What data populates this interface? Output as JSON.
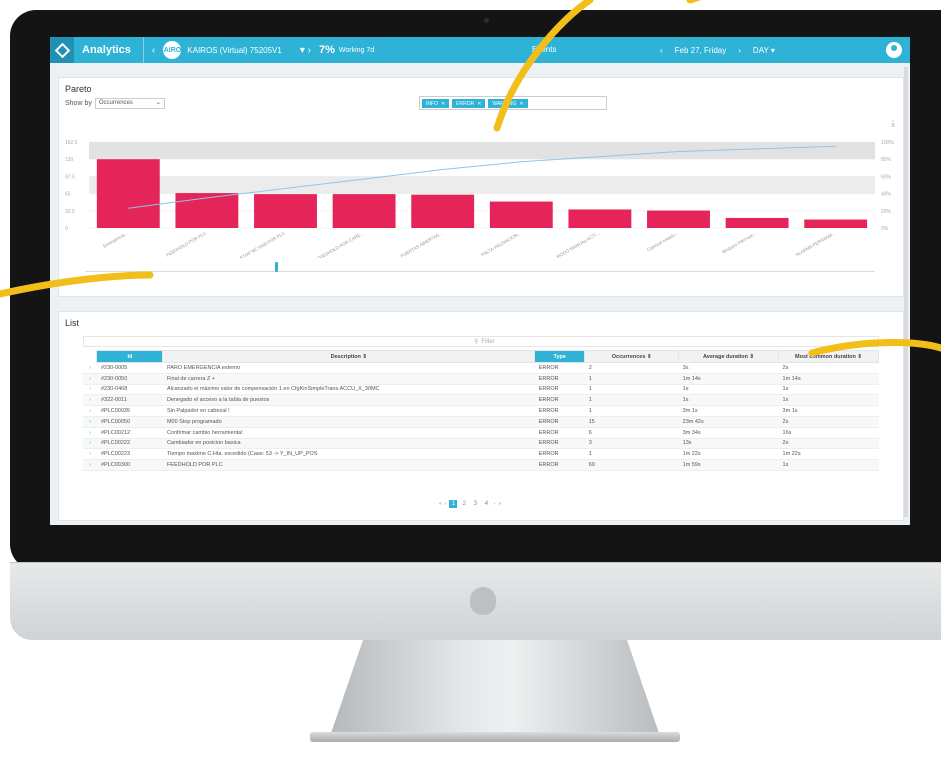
{
  "topbar": {
    "app_title": "Analytics",
    "machine_avatar": "KAIROS",
    "machine_name": "KAIROS (Virtual) 75205V1",
    "machine_pct": "7%",
    "machine_state": "Working 7d",
    "section": "Events",
    "date": "Feb 27, Friday",
    "period": "DAY"
  },
  "pareto": {
    "title": "Pareto",
    "show_by_label": "Show by",
    "show_by_value": "Occurrences",
    "filter_chips": [
      "INFO",
      "ERROR",
      "WARNING"
    ],
    "y_left_ticks": [
      "0",
      "32.5",
      "65",
      "97.5",
      "130",
      "162.5"
    ],
    "y_right_ticks": [
      "0%",
      "20%",
      "40%",
      "60%",
      "80%",
      "100%"
    ]
  },
  "chart_data": {
    "type": "bar",
    "title": "Pareto",
    "categories": [
      "Emergencia...",
      "FEEDHOLD POR PLC",
      "STOP NC HAB.POR PLC",
      "FEEDHOLD POR CARE...",
      "PUERTAS ABIERTAS...",
      "FALTA VALIDACION...",
      "MODO MANUAL ACTI...",
      "Cabezal estado...",
      "Bloqueo interrupc...",
      "ALARMA PERIDIAM..."
    ],
    "series": [
      {
        "values": [
          130,
          66,
          64,
          64,
          63,
          50,
          35,
          33,
          19,
          16
        ]
      },
      {
        "values": [
          23,
          35,
          46,
          57,
          68,
          77,
          83,
          89,
          92,
          95
        ]
      }
    ],
    "ylim": [
      0,
      162.5
    ],
    "y2lim": [
      0,
      100
    ],
    "colors": {
      "bars": "#e5245a",
      "line": "#8ec5e8"
    },
    "grid": true
  },
  "list": {
    "title": "List",
    "filter_placeholder": "Filter",
    "columns": [
      "Id",
      "Description ⇕",
      "Type",
      "Occurrences ⇕",
      "Average duration ⇕",
      "Most common duration ⇕"
    ],
    "rows": [
      [
        "#230-0005",
        "PARO EMERGENCIA externo",
        "ERROR",
        "2",
        "3s",
        "2s"
      ],
      [
        "#230-0050",
        "Final de carrera Z +",
        "ERROR",
        "1",
        "1m 14s",
        "1m 14s"
      ],
      [
        "#230-0468",
        "Alcanzado el máximo valor de compensación 1 en CfgKinSimpleTrans ACCU_X_30MC",
        "ERROR",
        "1",
        "1s",
        "1s"
      ],
      [
        "#322-0011",
        "Denegado el acceso a la tabla de puestos",
        "ERROR",
        "1",
        "1s",
        "1s"
      ],
      [
        "#PLC00035",
        "Sin Palpador en cabezal !",
        "ERROR",
        "1",
        "3m 1s",
        "3m 1s"
      ],
      [
        "#PLC00050",
        "M00 Stop programado",
        "ERROR",
        "15",
        "23m 42s",
        "2s"
      ],
      [
        "#PLC00212",
        "Confirmar cambio herramienta!",
        "ERROR",
        "6",
        "3m 34s",
        "16s"
      ],
      [
        "#PLC00222",
        "Cambiador en posicion basica",
        "ERROR",
        "3",
        "13s",
        "2s"
      ],
      [
        "#PLC00223",
        "Tiempo maximo C.Hta. excedido (Case: 53 -> Y_IN_UP_POS",
        "ERROR",
        "1",
        "1m 22s",
        "1m 22s"
      ],
      [
        "#PLC00300",
        "FEEDHOLD POR PLC",
        "ERROR",
        "69",
        "1m 59s",
        "1s"
      ]
    ],
    "pages": [
      "1",
      "2",
      "3",
      "4"
    ],
    "current_page": "1"
  },
  "colors": {
    "accent": "#2eb3d7",
    "bar": "#e5245a",
    "callout": "#f2be1a"
  }
}
